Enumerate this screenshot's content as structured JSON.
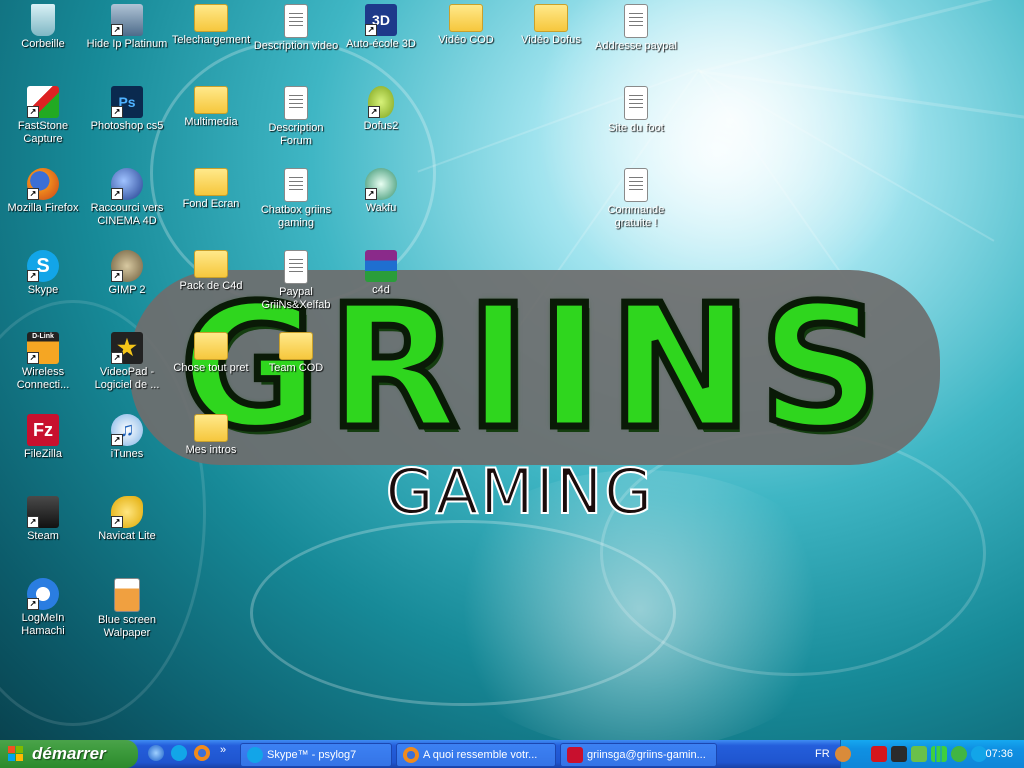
{
  "desktop": {
    "icons": [
      {
        "label": "Corbeille",
        "icon": "recycle-bin-icon"
      },
      {
        "label": "Hide Ip Platinum",
        "icon": "hide-ip-icon"
      },
      {
        "label": "Telechargement",
        "icon": "folder-icon"
      },
      {
        "label": "Description video",
        "icon": "text-document-icon"
      },
      {
        "label": "Auto-école 3D",
        "icon": "3d-app-icon"
      },
      {
        "label": "Vidéo COD",
        "icon": "folder-icon"
      },
      {
        "label": "Vidéo Dofus",
        "icon": "folder-icon"
      },
      {
        "label": "Addresse paypal",
        "icon": "text-document-icon"
      },
      {
        "label": "FastStone Capture",
        "icon": "faststone-icon"
      },
      {
        "label": "Photoshop cs5",
        "icon": "photoshop-icon"
      },
      {
        "label": "Multimedia",
        "icon": "folder-icon"
      },
      {
        "label": "Description Forum",
        "icon": "text-document-icon"
      },
      {
        "label": "Dofus2",
        "icon": "dofus-egg-icon"
      },
      {
        "label": "Site du foot",
        "icon": "text-document-icon"
      },
      {
        "label": "Mozilla Firefox",
        "icon": "firefox-icon"
      },
      {
        "label": "Raccourci vers CINEMA 4D",
        "icon": "cinema4d-icon"
      },
      {
        "label": "Fond Ecran",
        "icon": "image-folder-icon"
      },
      {
        "label": "Chatbox griins gaming",
        "icon": "text-document-icon"
      },
      {
        "label": "Wakfu",
        "icon": "wakfu-icon"
      },
      {
        "label": "Commande gratuite !",
        "icon": "text-document-icon"
      },
      {
        "label": "Skype",
        "icon": "skype-icon"
      },
      {
        "label": "GIMP 2",
        "icon": "gimp-icon"
      },
      {
        "label": "Pack de C4d",
        "icon": "folder-icon"
      },
      {
        "label": "Paypal GriiNs&Xelfab",
        "icon": "text-document-icon"
      },
      {
        "label": "c4d",
        "icon": "winrar-archive-icon"
      },
      {
        "label": "Wireless Connecti...",
        "icon": "dlink-icon"
      },
      {
        "label": "VideoPad - Logiciel de ...",
        "icon": "videopad-icon"
      },
      {
        "label": "Chose tout pret",
        "icon": "folder-icon"
      },
      {
        "label": "Team COD",
        "icon": "folder-icon"
      },
      {
        "label": "FileZilla",
        "icon": "filezilla-icon"
      },
      {
        "label": "iTunes",
        "icon": "itunes-icon"
      },
      {
        "label": "Mes intros",
        "icon": "folder-icon"
      },
      {
        "label": "Steam",
        "icon": "steam-icon"
      },
      {
        "label": "Navicat Lite",
        "icon": "navicat-icon"
      },
      {
        "label": "LogMeIn Hamachi",
        "icon": "hamachi-icon"
      },
      {
        "label": "Blue screen Walpaper",
        "icon": "image-file-icon"
      }
    ]
  },
  "wallpaper": {
    "logo_title": "GRIINS",
    "logo_subtitle": "GAMING",
    "accent_green": "#2fd61e"
  },
  "taskbar": {
    "start_label": "démarrer",
    "quick_launch": [
      "internet-explorer-icon",
      "skype-icon",
      "firefox-icon"
    ],
    "overflow": "»",
    "tasks": [
      {
        "label": "Skype™ - psylog7",
        "icon": "skype-icon"
      },
      {
        "label": "A quoi ressemble votr...",
        "icon": "firefox-icon"
      },
      {
        "label": "griinsga@griins-gamin...",
        "icon": "filezilla-icon"
      }
    ],
    "language": "FR",
    "clock": "07:36",
    "tray_icons": [
      "collapse-arrow-icon",
      "adobe-icon",
      "antivirus-icon",
      "hamachi-tray-icon",
      "network-signal-icon",
      "sync-icon",
      "skype-tray-icon"
    ]
  }
}
